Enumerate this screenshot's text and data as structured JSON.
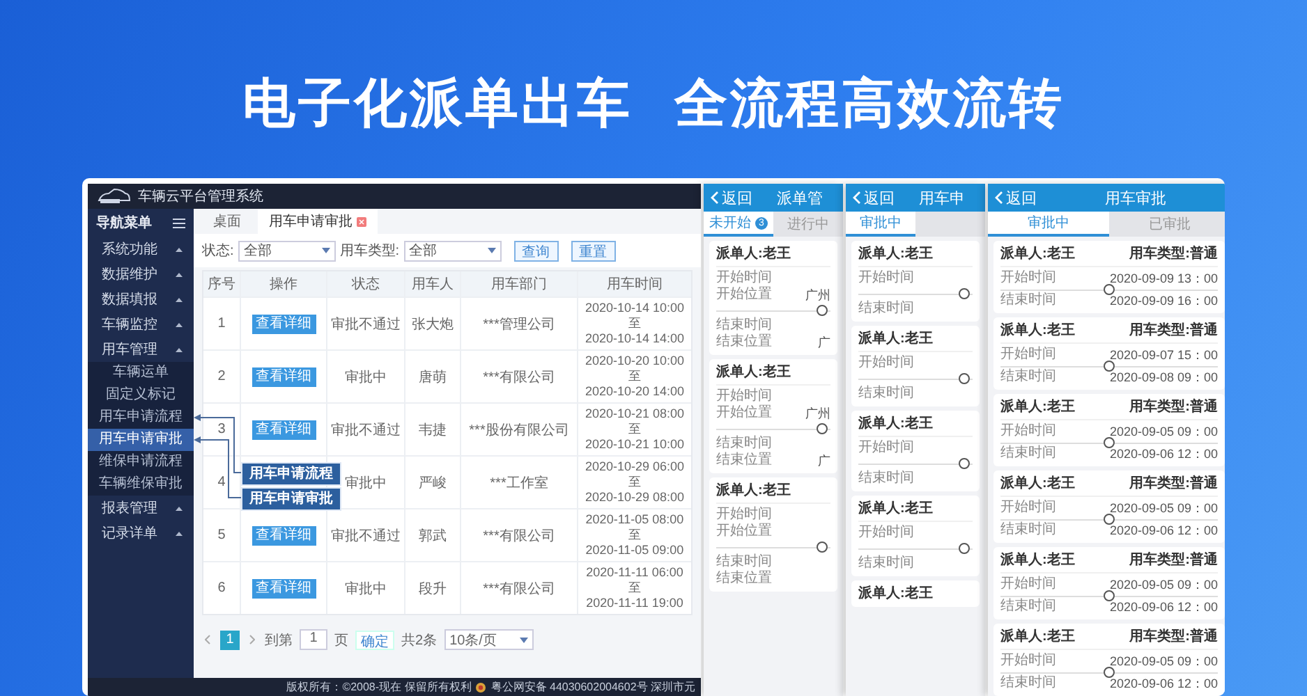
{
  "headline": [
    "电子化派单出车",
    "全流程高效流转"
  ],
  "admin": {
    "title": "车辆云平台管理系统",
    "nav_title": "导航菜单",
    "menu": [
      {
        "label": "系统功能"
      },
      {
        "label": "数据维护"
      },
      {
        "label": "数据填报"
      },
      {
        "label": "车辆监控"
      },
      {
        "label": "用车管理",
        "children": [
          {
            "label": "车辆运单",
            "selected": false
          },
          {
            "label": "固定义标记",
            "selected": false
          },
          {
            "label": "用车申请流程",
            "selected": false
          },
          {
            "label": "用车申请审批",
            "selected": true
          },
          {
            "label": "维保申请流程",
            "selected": false
          },
          {
            "label": "车辆维保审批",
            "selected": false
          }
        ]
      },
      {
        "label": "报表管理"
      },
      {
        "label": "记录详单"
      }
    ],
    "tabs": [
      {
        "label": "桌面",
        "selected": false,
        "closable": false
      },
      {
        "label": "用车申请审批",
        "selected": true,
        "closable": true
      }
    ],
    "filters": [
      {
        "label": "状态:",
        "value": "全部"
      },
      {
        "label": "用车类型:",
        "value": "全部"
      }
    ],
    "buttons": [
      "查询",
      "重置"
    ],
    "table": {
      "columns": [
        "序号",
        "操作",
        "状态",
        "用车人",
        "用车部门",
        "用车时间"
      ],
      "rows": [
        {
          "no": "1",
          "action": "查看详细",
          "status": "审批不通过",
          "user": "张大炮",
          "department": "***管理公司",
          "time": [
            "2020-10-14 10:00",
            "至",
            "2020-10-14 14:00"
          ]
        },
        {
          "no": "2",
          "action": "查看详细",
          "status": "审批中",
          "user": "唐萌",
          "department": "***有限公司",
          "time": [
            "2020-10-20 10:00",
            "至",
            "2020-10-20 14:00"
          ]
        },
        {
          "no": "3",
          "action": "查看详细",
          "status": "审批不通过",
          "user": "韦捷",
          "department": "***股份有限公司",
          "time": [
            "2020-10-21 08:00",
            "至",
            "2020-10-21 10:00"
          ]
        },
        {
          "no": "4",
          "status": "审批中",
          "user": "严峻",
          "department": "***工作室",
          "time": [
            "2020-10-29 06:00",
            "至",
            "2020-10-29 08:00"
          ]
        },
        {
          "no": "5",
          "action": "查看详细",
          "status": "审批不通过",
          "user": "郭武",
          "department": "***有限公司",
          "time": [
            "2020-11-05 08:00",
            "至",
            "2020-11-05 09:00"
          ]
        },
        {
          "no": "6",
          "action": "查看详细",
          "status": "审批中",
          "user": "段升",
          "department": "***有限公司",
          "time": [
            "2020-11-11 06:00",
            "至",
            "2020-11-11 19:00"
          ]
        }
      ]
    },
    "pagination": {
      "pages": [
        {
          "label": "1",
          "selected": true
        }
      ],
      "goto_label": "到第",
      "goto_value": "1",
      "page_unit": "页",
      "confirm": "确定",
      "total": "共2条",
      "page_size": "10条/页"
    },
    "footer": {
      "copyright": "版权所有：©2008-现在 保留所有权利",
      "record": "粤公网安备 44030602004602号 深圳市元"
    },
    "callouts": [
      {
        "label": "用车申请流程"
      },
      {
        "label": "用车申请审批"
      }
    ]
  },
  "phones": [
    {
      "back": "返回",
      "title": "派单管",
      "tabs": [
        {
          "label": "未开始",
          "badge": "3",
          "selected": true
        },
        {
          "label": "进行中",
          "selected": false
        }
      ],
      "cards": [
        {
          "dispatcher": "派单人:老王",
          "start": [
            {
              "label": "开始时间"
            },
            {
              "label": "开始位置",
              "value": "广州"
            }
          ],
          "end": [
            {
              "label": "结束时间"
            },
            {
              "label": "结束位置",
              "value": "广"
            }
          ]
        },
        {
          "dispatcher": "派单人:老王",
          "start": [
            {
              "label": "开始时间"
            },
            {
              "label": "开始位置",
              "value": "广州"
            }
          ],
          "end": [
            {
              "label": "结束时间"
            },
            {
              "label": "结束位置",
              "value": "广"
            }
          ]
        },
        {
          "dispatcher": "派单人:老王",
          "start": [
            {
              "label": "开始时间"
            },
            {
              "label": "开始位置"
            }
          ],
          "end": [
            {
              "label": "结束时间"
            },
            {
              "label": "结束位置"
            }
          ]
        }
      ]
    },
    {
      "back": "返回",
      "title": "用车申",
      "tabs": [
        {
          "label": "审批中",
          "selected": true
        }
      ],
      "cards": [
        {
          "dispatcher": "派单人:老王",
          "start": [
            {
              "label": "开始时间"
            }
          ],
          "end": [
            {
              "label": "结束时间"
            }
          ]
        },
        {
          "dispatcher": "派单人:老王",
          "start": [
            {
              "label": "开始时间"
            }
          ],
          "end": [
            {
              "label": "结束时间"
            }
          ]
        },
        {
          "dispatcher": "派单人:老王",
          "start": [
            {
              "label": "开始时间"
            }
          ],
          "end": [
            {
              "label": "结束时间"
            }
          ]
        },
        {
          "dispatcher": "派单人:老王",
          "start": [
            {
              "label": "开始时间"
            }
          ],
          "end": [
            {
              "label": "结束时间"
            }
          ]
        },
        {
          "dispatcher": "派单人:老王"
        }
      ]
    },
    {
      "back": "返回",
      "title": "用车审批",
      "tabs": [
        {
          "label": "审批中",
          "selected": true
        },
        {
          "label": "已审批",
          "selected": false
        }
      ],
      "cards": [
        {
          "dispatcher": "派单人:老王",
          "car_type": "用车类型:普通",
          "start": [
            {
              "label": "开始时间",
              "value": "2020-09-09 13：00"
            }
          ],
          "end": [
            {
              "label": "结束时间",
              "value": "2020-09-09 16：00"
            }
          ]
        },
        {
          "dispatcher": "派单人:老王",
          "car_type": "用车类型:普通",
          "start": [
            {
              "label": "开始时间",
              "value": "2020-09-07 15：00"
            }
          ],
          "end": [
            {
              "label": "结束时间",
              "value": "2020-09-08 09：00"
            }
          ]
        },
        {
          "dispatcher": "派单人:老王",
          "car_type": "用车类型:普通",
          "start": [
            {
              "label": "开始时间",
              "value": "2020-09-05 09：00"
            }
          ],
          "end": [
            {
              "label": "结束时间",
              "value": "2020-09-06 12：00"
            }
          ]
        },
        {
          "dispatcher": "派单人:老王",
          "car_type": "用车类型:普通",
          "start": [
            {
              "label": "开始时间",
              "value": "2020-09-05 09：00"
            }
          ],
          "end": [
            {
              "label": "结束时间",
              "value": "2020-09-06 12：00"
            }
          ]
        },
        {
          "dispatcher": "派单人:老王",
          "car_type": "用车类型:普通",
          "start": [
            {
              "label": "开始时间",
              "value": "2020-09-05 09：00"
            }
          ],
          "end": [
            {
              "label": "结束时间",
              "value": "2020-09-06 12：00"
            }
          ]
        },
        {
          "dispatcher": "派单人:老王",
          "car_type": "用车类型:普通",
          "start": [
            {
              "label": "开始时间",
              "value": "2020-09-05 09：00"
            }
          ],
          "end": [
            {
              "label": "结束时间",
              "value": "2020-09-06 12：00"
            }
          ]
        }
      ]
    }
  ]
}
